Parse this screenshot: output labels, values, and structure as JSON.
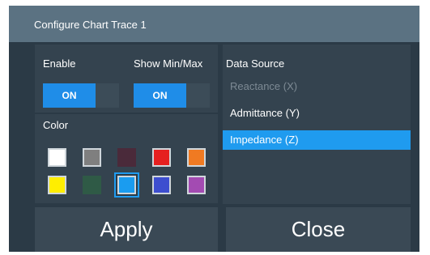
{
  "dialog": {
    "title": "Configure Chart Trace 1"
  },
  "enable": {
    "label": "Enable",
    "value": "ON",
    "on": true
  },
  "show_min_max": {
    "label": "Show Min/Max",
    "value": "ON",
    "on": true
  },
  "color": {
    "label": "Color",
    "swatches": [
      {
        "hex": "#ffffff",
        "enabled": true
      },
      {
        "hex": "#7f7f7f",
        "enabled": true
      },
      {
        "hex": "#4a2a3a",
        "enabled": false
      },
      {
        "hex": "#e52020",
        "enabled": true
      },
      {
        "hex": "#f07a22",
        "enabled": true
      },
      {
        "hex": "#ffee00",
        "enabled": true
      },
      {
        "hex": "#2f5a46",
        "enabled": false
      },
      {
        "hex": "#1a9cf0",
        "enabled": true,
        "selected": true
      },
      {
        "hex": "#3d4ecf",
        "enabled": true
      },
      {
        "hex": "#a34bb2",
        "enabled": true
      }
    ]
  },
  "data_source": {
    "label": "Data Source",
    "items": [
      {
        "label": "Reactance (X)",
        "state": "disabled"
      },
      {
        "label": "Admittance (Y)",
        "state": "normal"
      },
      {
        "label": "Impedance (Z)",
        "state": "selected"
      }
    ]
  },
  "buttons": {
    "apply": "Apply",
    "close": "Close"
  },
  "colors": {
    "accent": "#1f9bef",
    "toggle_on": "#1f8de8",
    "dialog_bg": "#2b3a46",
    "titlebar_bg": "#5b7282"
  }
}
